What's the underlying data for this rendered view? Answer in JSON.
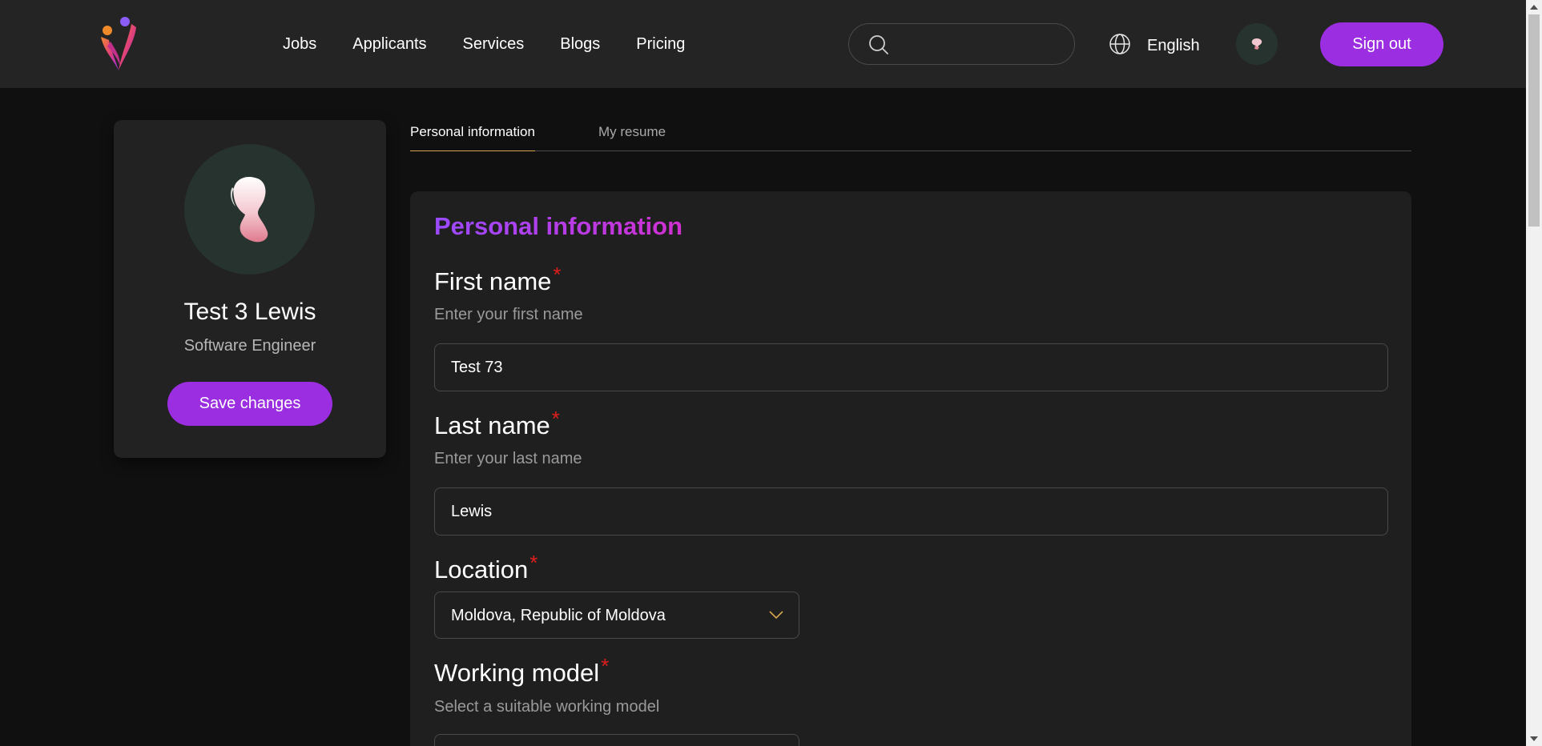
{
  "header": {
    "nav": [
      "Jobs",
      "Applicants",
      "Services",
      "Blogs",
      "Pricing"
    ],
    "search_placeholder": "",
    "language": "English",
    "signout_label": "Sign out"
  },
  "profile": {
    "name": "Test 3 Lewis",
    "title": "Software Engineer",
    "save_label": "Save changes"
  },
  "tabs": [
    {
      "label": "Personal information",
      "active": true
    },
    {
      "label": "My resume",
      "active": false
    }
  ],
  "form": {
    "section_title": "Personal information",
    "first_name": {
      "label": "First name",
      "required": "*",
      "hint": "Enter your first name",
      "value": "Test 73"
    },
    "last_name": {
      "label": "Last name",
      "required": "*",
      "hint": "Enter your last name",
      "value": "Lewis"
    },
    "location": {
      "label": "Location",
      "required": "*",
      "value": "Moldova, Republic of Moldova"
    },
    "working_model": {
      "label": "Working model",
      "required": "*",
      "hint": "Select a suitable working model"
    }
  },
  "colors": {
    "accent": "#9b2ee0",
    "required": "#e11d1d",
    "tab_underline": "#d4a64f"
  }
}
